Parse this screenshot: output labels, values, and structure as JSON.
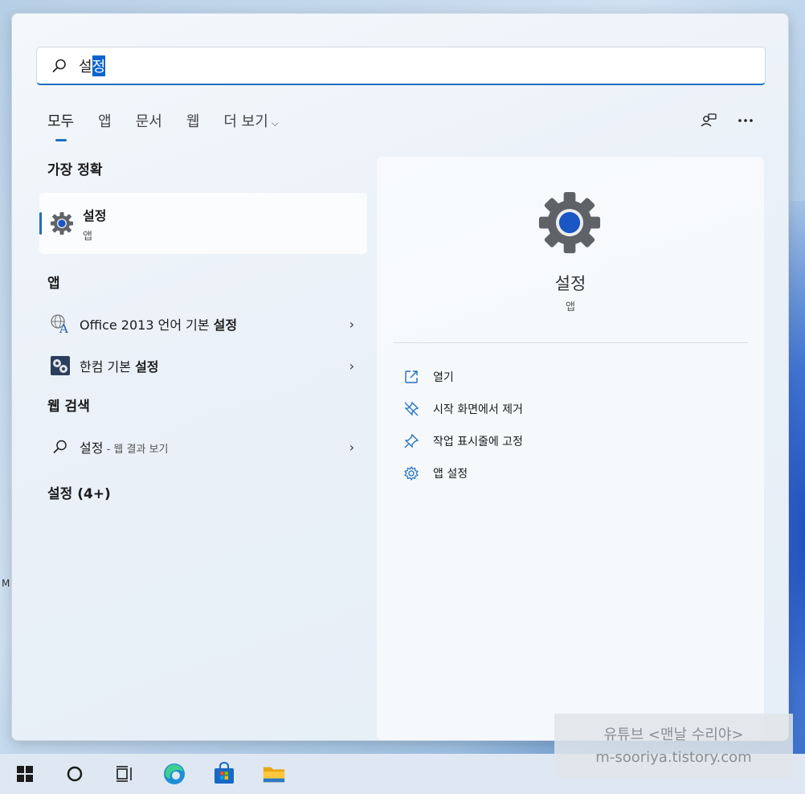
{
  "search": {
    "text_plain": "설",
    "text_selected": "정"
  },
  "tabs": [
    {
      "label": "모두"
    },
    {
      "label": "앱"
    },
    {
      "label": "문서"
    },
    {
      "label": "웹"
    },
    {
      "label": "더 보기"
    }
  ],
  "left": {
    "best_match_title": "가장 정확",
    "best_match": {
      "name": "설정",
      "type": "앱"
    },
    "apps_title": "앱",
    "apps": [
      {
        "prefix": "Office 2013 언어 기본 ",
        "bold": "설정"
      },
      {
        "prefix": "한컴 기본 ",
        "bold": "설정"
      }
    ],
    "web_title": "웹 검색",
    "web_query": "설정",
    "web_suffix": " - 웹 결과 보기",
    "settings_title": "설정 (4+)"
  },
  "right": {
    "name": "설정",
    "type": "앱",
    "actions": [
      {
        "label": "열기",
        "icon": "open-icon"
      },
      {
        "label": "시작 화면에서 제거",
        "icon": "unpin-icon"
      },
      {
        "label": "작업 표시줄에 고정",
        "icon": "pin-icon"
      },
      {
        "label": "앱 설정",
        "icon": "gear-icon"
      }
    ]
  },
  "desktop_letter": "M",
  "watermark": {
    "line1": "유튜브 <맨날 수리야>",
    "line2": "m-sooriya.tistory.com"
  },
  "colors": {
    "accent": "#1f6fc0",
    "selection": "#0a64d0"
  }
}
